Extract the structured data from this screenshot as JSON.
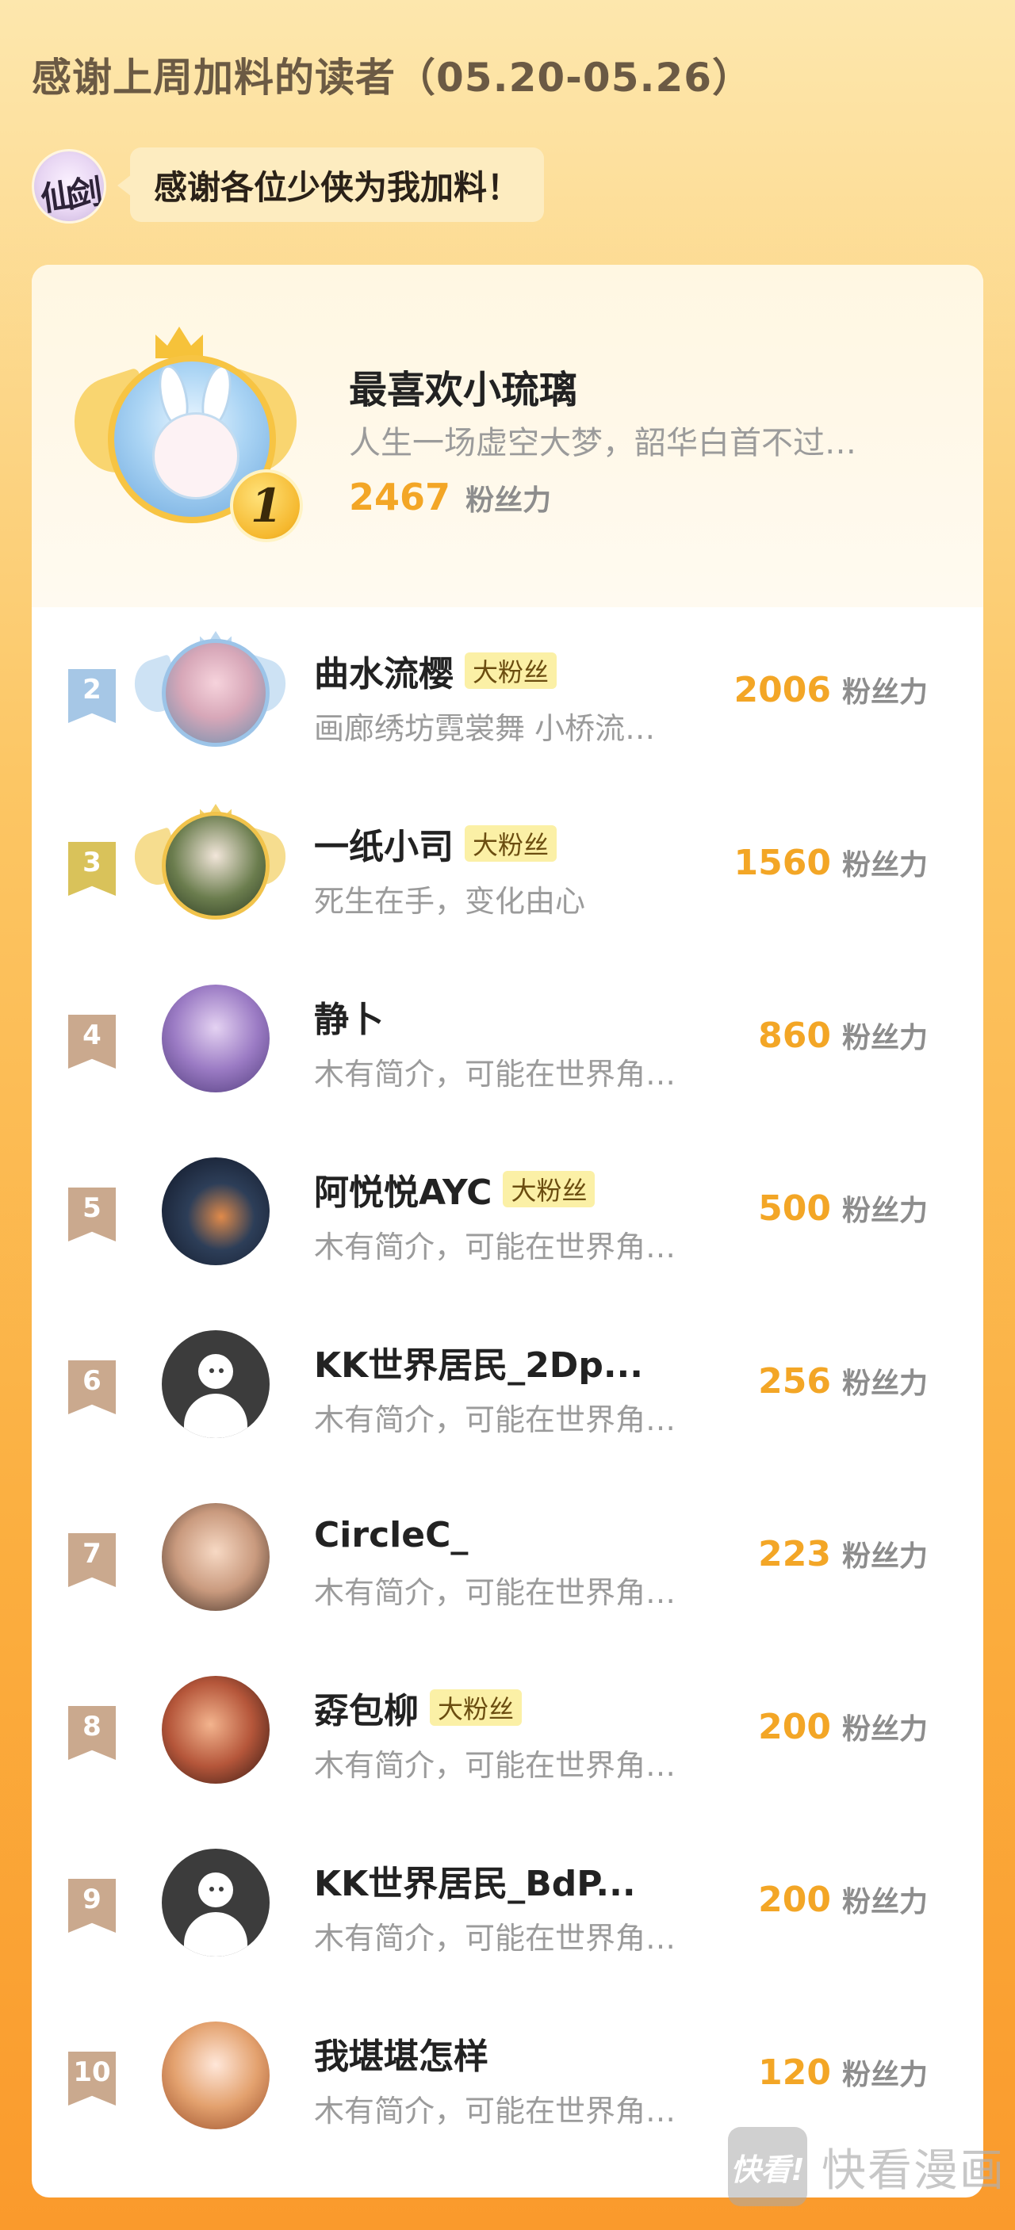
{
  "header": {
    "title": "感谢上周加料的读者（05.20-05.26）"
  },
  "author": {
    "logo_text": "仙剑",
    "message": "感谢各位少侠为我加料！"
  },
  "top_fan": {
    "rank": "1",
    "name": "最喜欢小琉璃",
    "bio": "人生一场虚空大梦，韶华白首不过…",
    "power": "2467",
    "power_unit": "粉丝力"
  },
  "rank_colors": {
    "2": "#a6c7e6",
    "3": "#d9c25a",
    "4": "#caa98e",
    "5": "#caa98e",
    "6": "#caa98e",
    "7": "#caa98e",
    "8": "#caa98e",
    "9": "#caa98e",
    "10": "#caa98e"
  },
  "fans": [
    {
      "rank": "2",
      "name": "曲水流樱",
      "tag": "大粉丝",
      "bio": "画廊绣坊霓裳舞 小桥流…",
      "power": "2006",
      "power_unit": "粉丝力"
    },
    {
      "rank": "3",
      "name": "一纸小司",
      "tag": "大粉丝",
      "bio": "死生在手，变化由心",
      "power": "1560",
      "power_unit": "粉丝力"
    },
    {
      "rank": "4",
      "name": "静卜",
      "tag": "",
      "bio": "木有简介，可能在世界角落…",
      "power": "860",
      "power_unit": "粉丝力"
    },
    {
      "rank": "5",
      "name": "阿悦悦AYC",
      "tag": "大粉丝",
      "bio": "木有简介，可能在世界角落…",
      "power": "500",
      "power_unit": "粉丝力"
    },
    {
      "rank": "6",
      "name": "KK世界居民_2Dp...",
      "tag": "",
      "bio": "木有简介，可能在世界角落…",
      "power": "256",
      "power_unit": "粉丝力"
    },
    {
      "rank": "7",
      "name": "CircleC_",
      "tag": "",
      "bio": "木有简介，可能在世界角落…",
      "power": "223",
      "power_unit": "粉丝力"
    },
    {
      "rank": "8",
      "name": "孬包柳",
      "tag": "大粉丝",
      "bio": "木有简介，可能在世界角落…",
      "power": "200",
      "power_unit": "粉丝力"
    },
    {
      "rank": "9",
      "name": "KK世界居民_BdP...",
      "tag": "",
      "bio": "木有简介，可能在世界角落…",
      "power": "200",
      "power_unit": "粉丝力"
    },
    {
      "rank": "10",
      "name": "我堪堪怎样",
      "tag": "",
      "bio": "木有简介，可能在世界角落…",
      "power": "120",
      "power_unit": "粉丝力"
    }
  ],
  "watermark": {
    "box_text": "快看!",
    "text": "快看漫画"
  }
}
